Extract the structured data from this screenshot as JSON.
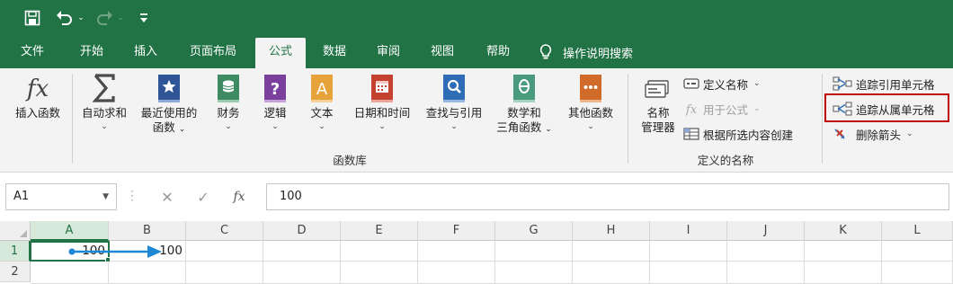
{
  "titlebar": {
    "save_icon": "save-icon",
    "undo_icon": "undo-icon",
    "redo_icon": "redo-icon",
    "customize_icon": "customize-qat-icon",
    "colors": {
      "bg": "#217346"
    }
  },
  "tabs": [
    {
      "label": "文件"
    },
    {
      "label": "开始"
    },
    {
      "label": "插入"
    },
    {
      "label": "页面布局"
    },
    {
      "label": "公式",
      "active": true
    },
    {
      "label": "数据"
    },
    {
      "label": "审阅"
    },
    {
      "label": "视图"
    },
    {
      "label": "帮助"
    }
  ],
  "tell_me": {
    "label": "操作说明搜索",
    "icon": "lightbulb-icon"
  },
  "ribbon": {
    "function_library": {
      "label": "函数库",
      "insert_function": {
        "label": "插入函数",
        "icon": "fx-icon"
      },
      "autosum": {
        "label": "自动求和",
        "icon": "sigma-icon"
      },
      "recent": {
        "label1": "最近使用的",
        "label2": "函数",
        "icon": "book-star-icon"
      },
      "financial": {
        "label": "财务",
        "icon": "book-coins-icon"
      },
      "logical": {
        "label": "逻辑",
        "icon": "book-question-icon"
      },
      "text": {
        "label": "文本",
        "icon": "book-a-icon"
      },
      "datetime": {
        "label": "日期和时间",
        "icon": "book-calendar-icon"
      },
      "lookup": {
        "label": "查找与引用",
        "icon": "book-magnifier-icon"
      },
      "math": {
        "label1": "数学和",
        "label2": "三角函数",
        "icon": "book-theta-icon"
      },
      "more": {
        "label": "其他函数",
        "icon": "book-dots-icon"
      }
    },
    "defined_names": {
      "label": "定义的名称",
      "name_manager": {
        "label1": "名称",
        "label2": "管理器",
        "icon": "name-manager-icon"
      },
      "define_name": {
        "label": "定义名称",
        "icon": "tag-icon"
      },
      "use_in_formula": {
        "label": "用于公式",
        "icon": "fx-small-icon"
      },
      "create_from_selection": {
        "label": "根据所选内容创建",
        "icon": "grid-create-icon"
      }
    },
    "formula_auditing": {
      "trace_precedents": {
        "label": "追踪引用单元格",
        "icon": "trace-precedents-icon"
      },
      "trace_dependents": {
        "label": "追踪从属单元格",
        "icon": "trace-dependents-icon"
      },
      "remove_arrows": {
        "label": "删除箭头",
        "icon": "remove-arrows-icon"
      }
    }
  },
  "formula_bar": {
    "name_box": "A1",
    "cancel_icon": "cancel-icon",
    "enter_icon": "check-icon",
    "fx_label": "fx",
    "value": "100"
  },
  "grid": {
    "columns": [
      "A",
      "B",
      "C",
      "D",
      "E",
      "F",
      "G",
      "H",
      "I",
      "J",
      "K",
      "L"
    ],
    "rows": [
      "1",
      "2"
    ],
    "cells": {
      "A1": "100",
      "B1": "100"
    },
    "selected": "A1",
    "arrow_color": "#1e88d6"
  }
}
